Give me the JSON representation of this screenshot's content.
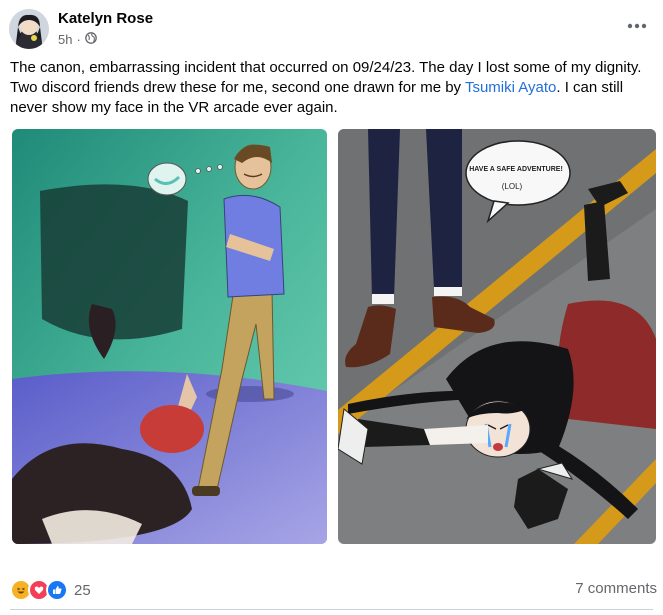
{
  "post": {
    "author": "Katelyn Rose",
    "time": "5h",
    "privacy_icon": "globe-icon",
    "more_icon": "more-horizontal-icon",
    "caption_part1": "The canon, embarrassing incident that occurred on 09/24/23. The day I lost some of my dignity. Two discord friends drew these for me, second one drawn for me by ",
    "mention": "Tsumiki Ayato",
    "caption_part2": ". I can still never show my face in the VR arcade ever again.",
    "comic_speech": "HAVE A SAFE ADVENTURE!",
    "comic_lol": "(LOL)"
  },
  "footer": {
    "reaction_icons": [
      "haha-icon",
      "love-icon",
      "like-icon"
    ],
    "reaction_count": "25",
    "comments_label": "7 comments"
  },
  "colors": {
    "link": "#216fdb",
    "secondary_text": "#65676b",
    "teal_wall": "#2f9a86",
    "road": "#7d7f80",
    "road_stripe": "#d59a1a",
    "skirt_red": "#8e2a2a"
  }
}
